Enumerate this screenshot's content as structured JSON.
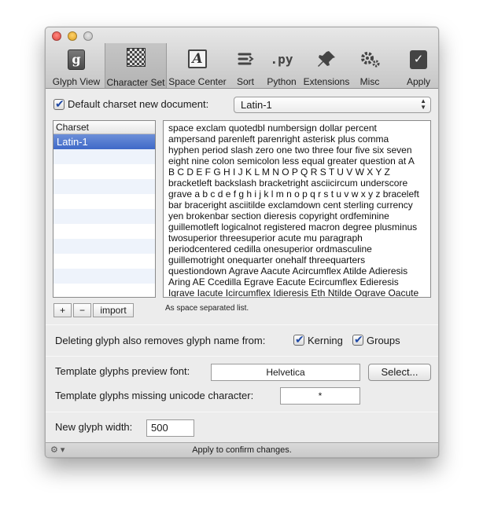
{
  "toolbar": {
    "items": [
      {
        "label": "Glyph View",
        "icon": "glyph-view-icon"
      },
      {
        "label": "Character Set",
        "icon": "character-set-icon"
      },
      {
        "label": "Space Center",
        "icon": "space-center-icon"
      },
      {
        "label": "Sort",
        "icon": "sort-icon"
      },
      {
        "label": "Python",
        "icon": "python-icon",
        "glyph": ".py"
      },
      {
        "label": "Extensions",
        "icon": "extensions-icon"
      },
      {
        "label": "Misc",
        "icon": "misc-icon"
      },
      {
        "label": "Apply",
        "icon": "apply-icon"
      }
    ],
    "active": "Character Set",
    "glyph_letter": "g",
    "space_letter": "A"
  },
  "charset": {
    "default_label": "Default charset new document:",
    "default_checked": true,
    "default_value": "Latin-1",
    "list_header": "Charset",
    "list_items": [
      "Latin-1"
    ],
    "selected": "Latin-1",
    "add_label": "+",
    "remove_label": "−",
    "import_label": "import",
    "hint": "As space separated list.",
    "glyph_lines": [
      "space exclam quotedbl numbersign dollar percent",
      "ampersand parenleft parenright asterisk plus comma",
      "hyphen period slash zero one two three four five six seven",
      "eight nine colon semicolon less equal greater question at A",
      "B C D E F G H I J K L M N O P Q R S T U V W X Y Z",
      "bracketleft backslash bracketright asciicircum underscore",
      "grave a b c d e f g h i j k l m n o p q r s t u v w x y z braceleft",
      "bar braceright asciitilde exclamdown cent sterling currency",
      "yen brokenbar section dieresis copyright ordfeminine",
      "guillemotleft logicalnot registered macron degree plusminus",
      "twosuperior threesuperior acute mu paragraph",
      "periodcentered cedilla onesuperior ordmasculine",
      "guillemotright onequarter onehalf threequarters",
      "questiondown Agrave Aacute Acircumflex Atilde Adieresis",
      "Aring AE Ccedilla Egrave Eacute Ecircumflex Edieresis",
      "Igrave Iacute Icircumflex Idieresis Eth Ntilde Ograve Oacute"
    ]
  },
  "delete": {
    "label": "Deleting glyph also removes glyph name from:",
    "kerning_label": "Kerning",
    "kerning_checked": true,
    "groups_label": "Groups",
    "groups_checked": true
  },
  "template": {
    "font_label": "Template glyphs preview font:",
    "font_value": "Helvetica",
    "select_label": "Select...",
    "missing_label": "Template glyphs missing unicode character:",
    "missing_value": "*"
  },
  "glyph_width": {
    "label": "New glyph width:",
    "value": "500"
  },
  "status": {
    "text": "Apply to confirm changes."
  },
  "colors": {
    "selection": "#3f69c8",
    "check": "#1f49a5"
  }
}
